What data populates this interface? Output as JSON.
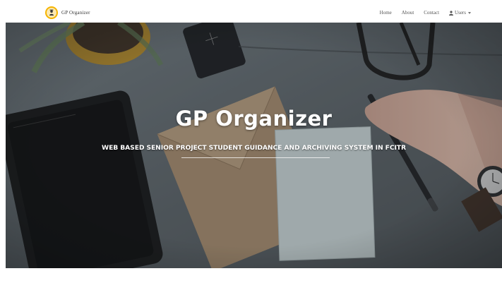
{
  "navbar": {
    "brand": "GP Organizer",
    "links": {
      "home": "Home",
      "about": "About",
      "contact": "Contact",
      "users": "Users"
    }
  },
  "hero": {
    "title": "GP Organizer",
    "subtitle": "WEB BASED SENIOR PROJECT STUDENT GUIDANCE AND ARCHIVING SYSTEM IN FCITR"
  },
  "icons": {
    "brand_logo": "graduate-logo-icon",
    "users": "user-icon",
    "dropdown": "caret-down-icon"
  },
  "colors": {
    "brand_logo": "#f5b400",
    "hero_text": "#ffffff",
    "nav_text": "#555555"
  }
}
